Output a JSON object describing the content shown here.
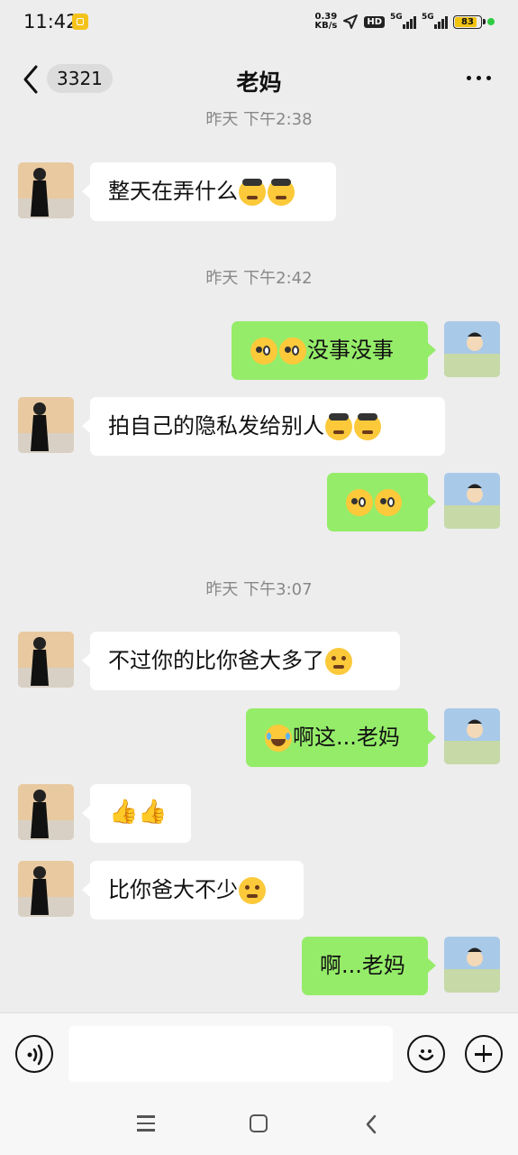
{
  "status_bar": {
    "time": "11:42",
    "net_speed_value": "0.39",
    "net_speed_unit": "KB/s",
    "hd_label": "HD",
    "signal_labels": [
      "5G",
      "5G"
    ],
    "battery": "83"
  },
  "header": {
    "back_icon": "chevron-left-icon",
    "unread_count": "3321",
    "title": "老妈",
    "more_icon": "more-dots-icon"
  },
  "messages": [
    {
      "type": "timestamp",
      "text": "昨天 下午2:38"
    },
    {
      "type": "message",
      "side": "left",
      "text": "整天在弄什么",
      "emojis": [
        "facepalm",
        "facepalm"
      ]
    },
    {
      "type": "timestamp",
      "text": "昨天 下午2:42"
    },
    {
      "type": "message",
      "side": "right",
      "lead_emojis": [
        "wink",
        "wink"
      ],
      "text": "没事没事"
    },
    {
      "type": "message",
      "side": "left",
      "text": "拍自己的隐私发给别人",
      "emojis": [
        "facepalm",
        "facepalm"
      ]
    },
    {
      "type": "message",
      "side": "right",
      "lead_emojis": [
        "wink",
        "wink"
      ],
      "text": ""
    },
    {
      "type": "timestamp",
      "text": "昨天 下午3:07"
    },
    {
      "type": "message",
      "side": "left",
      "text": "不过你的比你爸大多了",
      "emojis": [
        "shy"
      ]
    },
    {
      "type": "message",
      "side": "right",
      "lead_emojis": [
        "laugh"
      ],
      "text": "啊这...老妈"
    },
    {
      "type": "message",
      "side": "left",
      "text": "",
      "emojis": [
        "thumbs-up",
        "thumbs-up"
      ]
    },
    {
      "type": "message",
      "side": "left",
      "text": "比你爸大不少",
      "emojis": [
        "shy"
      ]
    },
    {
      "type": "message",
      "side": "right",
      "text": "啊...老妈"
    }
  ],
  "input_bar": {
    "voice_icon": "voice-icon",
    "text_value": "",
    "emoji_icon": "smiley-icon",
    "plus_icon": "plus-icon"
  },
  "nav_bar": {
    "menu_icon": "menu-icon",
    "home_icon": "home-square-icon",
    "back_icon": "back-chevron-icon"
  },
  "colors": {
    "background": "#ededed",
    "outgoing_bubble": "#95ec69",
    "incoming_bubble": "#ffffff"
  }
}
